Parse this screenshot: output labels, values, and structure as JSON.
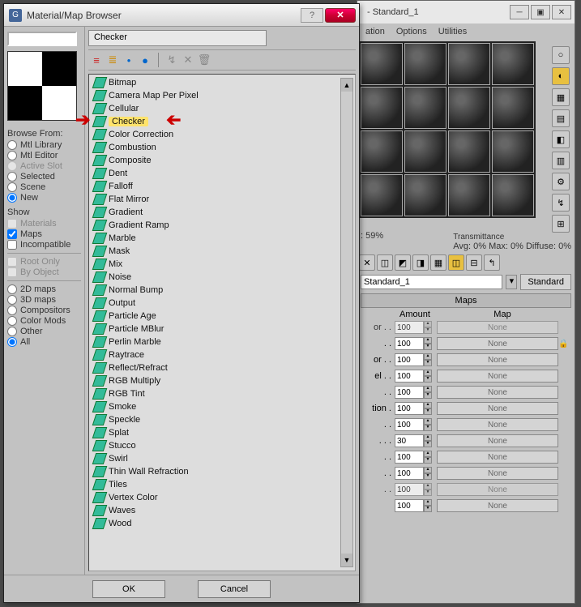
{
  "dialog": {
    "title": "Material/Map Browser",
    "selected": "Checker"
  },
  "side": {
    "browse_label": "Browse From:",
    "browse": [
      {
        "label": "Mtl Library",
        "sel": false,
        "dim": false
      },
      {
        "label": "Mtl Editor",
        "sel": false,
        "dim": false
      },
      {
        "label": "Active Slot",
        "sel": false,
        "dim": true
      },
      {
        "label": "Selected",
        "sel": false,
        "dim": false
      },
      {
        "label": "Scene",
        "sel": false,
        "dim": false
      },
      {
        "label": "New",
        "sel": true,
        "dim": false
      }
    ],
    "show_label": "Show",
    "show": [
      {
        "label": "Materials",
        "sel": false,
        "dim": true
      },
      {
        "label": "Maps",
        "sel": true,
        "dim": false
      },
      {
        "label": "Incompatible",
        "sel": false,
        "dim": false
      }
    ],
    "showextra": [
      {
        "label": "Root Only",
        "sel": false,
        "dim": true
      },
      {
        "label": "By Object",
        "sel": false,
        "dim": true
      }
    ],
    "cat": [
      {
        "label": "2D maps",
        "sel": false
      },
      {
        "label": "3D maps",
        "sel": false
      },
      {
        "label": "Compositors",
        "sel": false
      },
      {
        "label": "Color Mods",
        "sel": false
      },
      {
        "label": "Other",
        "sel": false
      },
      {
        "label": "All",
        "sel": true
      }
    ]
  },
  "maps": [
    "Bitmap",
    "Camera Map Per Pixel",
    "Cellular",
    "Checker",
    "Color Correction",
    "Combustion",
    "Composite",
    "Dent",
    "Falloff",
    "Flat Mirror",
    "Gradient",
    "Gradient Ramp",
    "Marble",
    "Mask",
    "Mix",
    "Noise",
    "Normal Bump",
    "Output",
    "Particle Age",
    "Particle MBlur",
    "Perlin Marble",
    "Raytrace",
    "Reflect/Refract",
    "RGB Multiply",
    "RGB Tint",
    "Smoke",
    "Speckle",
    "Splat",
    "Stucco",
    "Swirl",
    "Thin Wall Refraction",
    "Tiles",
    "Vertex Color",
    "Waves",
    "Wood"
  ],
  "highlight_index": 3,
  "footer": {
    "ok": "OK",
    "cancel": "Cancel"
  },
  "bg": {
    "title": "- Standard_1",
    "menu": [
      "ation",
      "Options",
      "Utilities"
    ],
    "trans_hdr": "Transmittance",
    "trans": "Avg:  0% Max:  0% Diffuse:  0%",
    "stat_left": ": 59%",
    "name": "Standard_1",
    "type_btn": "Standard",
    "maps_hdr": "Maps",
    "col_amount": "Amount",
    "col_map": "Map",
    "rows": [
      {
        "label": "or . .",
        "amt": "100",
        "dim": true
      },
      {
        "label": ". .",
        "amt": "100",
        "dim": false
      },
      {
        "label": "or . .",
        "amt": "100",
        "dim": false
      },
      {
        "label": "el . .",
        "amt": "100",
        "dim": false
      },
      {
        "label": ". .",
        "amt": "100",
        "dim": false
      },
      {
        "label": "tion .",
        "amt": "100",
        "dim": false
      },
      {
        "label": ". .",
        "amt": "100",
        "dim": false
      },
      {
        "label": ". . .",
        "amt": "30",
        "dim": false
      },
      {
        "label": ". .",
        "amt": "100",
        "dim": false
      },
      {
        "label": ". .",
        "amt": "100",
        "dim": false
      },
      {
        "label": ". .",
        "amt": "100",
        "dim": true
      },
      {
        "label": "",
        "amt": "100",
        "dim": false
      }
    ],
    "none": "None"
  }
}
